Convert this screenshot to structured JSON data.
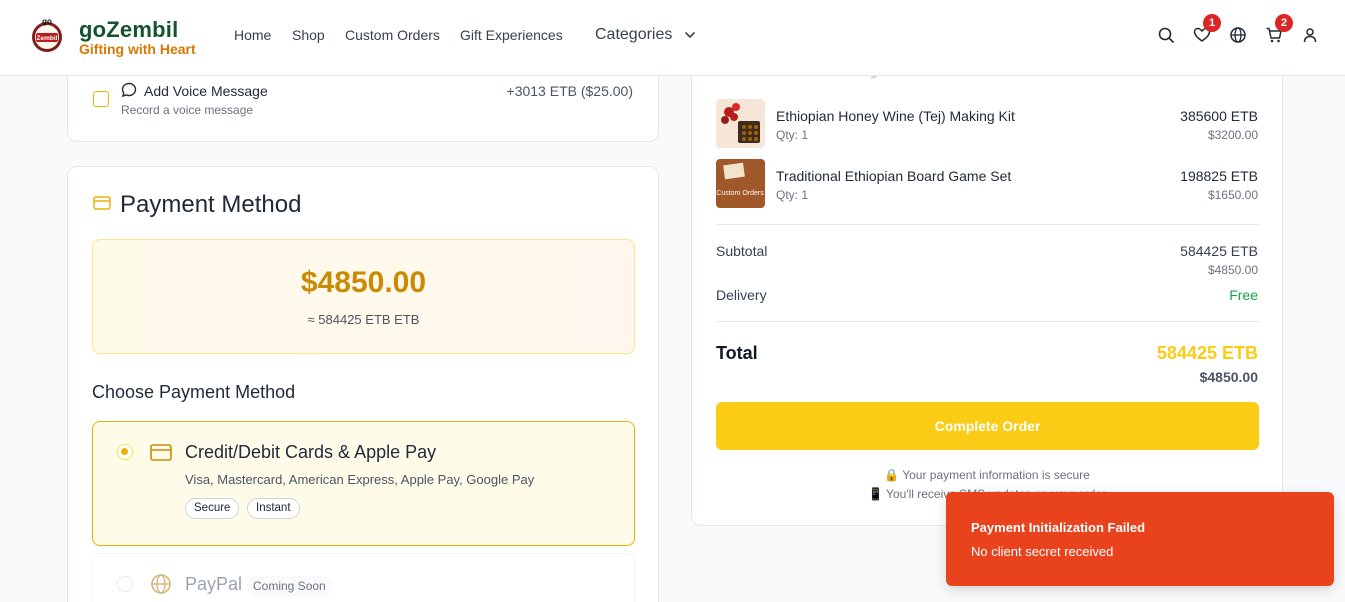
{
  "brand": {
    "name": "goZembil",
    "tagline": "Gifting with Heart",
    "badge_top": "go",
    "badge_bottom": "Zembil"
  },
  "nav": {
    "items": [
      "Home",
      "Shop",
      "Custom Orders",
      "Gift Experiences"
    ],
    "categories": "Categories"
  },
  "header_icons": {
    "wishlist_count": "1",
    "cart_count": "2",
    "icons": [
      "search-icon",
      "heart-icon",
      "globe-icon",
      "cart-icon",
      "user-icon"
    ]
  },
  "voice_message": {
    "title": "Add Voice Message",
    "subtitle": "Record a voice message",
    "price": "+3013 ETB ($25.00)"
  },
  "payment": {
    "title": "Payment Method",
    "amount_usd": "$4850.00",
    "amount_etb": "≈ 584425 ETB ETB",
    "choose_title": "Choose Payment Method",
    "options": [
      {
        "title": "Credit/Debit Cards & Apple Pay",
        "subtitle": "Visa, Mastercard, American Express, Apple Pay, Google Pay",
        "tags": [
          "Secure",
          "Instant"
        ],
        "selected": true
      },
      {
        "title": "PayPal",
        "badge": "Coming Soon",
        "selected": false
      }
    ]
  },
  "summary": {
    "title": "Order Summary",
    "items": [
      {
        "name": "Ethiopian Honey Wine (Tej) Making Kit",
        "qty": "Qty: 1",
        "price_etb": "385600 ETB",
        "price_usd": "$3200.00"
      },
      {
        "name": "Traditional Ethiopian Board Game Set",
        "qty": "Qty: 1",
        "price_etb": "198825 ETB",
        "price_usd": "$1650.00",
        "image_text": "Custom Orders"
      }
    ],
    "subtotal_label": "Subtotal",
    "subtotal_etb": "584425 ETB",
    "subtotal_usd": "$4850.00",
    "delivery_label": "Delivery",
    "delivery_value": "Free",
    "total_label": "Total",
    "total_etb": "584425 ETB",
    "total_usd": "$4850.00",
    "complete_button": "Complete Order",
    "secure_note": "🔒 Your payment information is secure",
    "sms_note": "📱 You'll receive SMS updates on your order"
  },
  "toast": {
    "title": "Payment Initialization Failed",
    "message": "No client secret received"
  },
  "colors": {
    "accent": "#facc15",
    "brand_green": "#14532d",
    "brand_orange": "#d97706",
    "error": "#e8431c",
    "success": "#16a34a"
  }
}
